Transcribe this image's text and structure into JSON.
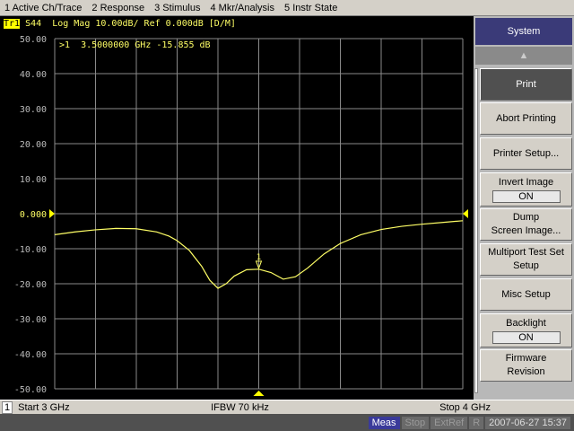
{
  "menu": [
    "1 Active Ch/Trace",
    "2 Response",
    "3 Stimulus",
    "4 Mkr/Analysis",
    "5 Instr State"
  ],
  "trace_header": {
    "trace": "Tr1",
    "text": "S44  Log Mag 10.00dB/ Ref 0.000dB [D/M]"
  },
  "marker_readout": ">1  3.5000000 GHz -15.855 dB",
  "marker_label": "1",
  "colors": {
    "trace": "#ffff66",
    "grid": "#8a8a8a",
    "softkey_title": "#3a3a78",
    "status_meas": "#3a3a9a"
  },
  "chart_data": {
    "type": "line",
    "ylim": [
      -50,
      50
    ],
    "xlim": [
      3.0,
      4.0
    ],
    "yticks": [
      "50.00",
      "40.00",
      "30.00",
      "20.00",
      "10.00",
      "0.000",
      "-10.00",
      "-20.00",
      "-30.00",
      "-40.00",
      "-50.00"
    ],
    "grid": true,
    "series": [
      {
        "x": [
          3.0,
          3.05,
          3.1,
          3.15,
          3.2,
          3.25,
          3.28,
          3.3,
          3.33,
          3.36,
          3.38,
          3.4,
          3.42,
          3.44,
          3.47,
          3.5,
          3.53,
          3.56,
          3.59,
          3.62,
          3.66,
          3.7,
          3.75,
          3.8,
          3.85,
          3.9,
          3.95,
          4.0
        ],
        "y": [
          -6.0,
          -5.2,
          -4.6,
          -4.2,
          -4.3,
          -5.2,
          -6.4,
          -7.7,
          -10.5,
          -15,
          -19,
          -21.3,
          -20,
          -17.8,
          -16,
          -15.855,
          -16.8,
          -18.7,
          -18,
          -15.5,
          -11.5,
          -8.5,
          -6,
          -4.5,
          -3.6,
          -3,
          -2.5,
          -2.0
        ]
      }
    ],
    "marker": {
      "x": 3.5,
      "y": -15.855
    }
  },
  "footer": {
    "channel": "1",
    "start": "Start 3 GHz",
    "ifbw": "IFBW 70 kHz",
    "stop": "Stop 4 GHz"
  },
  "status": [
    "Meas",
    "Stop",
    "ExtRef",
    "R",
    "2007-06-27 15:37"
  ],
  "softkeys": {
    "title": "System",
    "items": [
      {
        "label": "Print"
      },
      {
        "label": "Abort Printing"
      },
      {
        "label": "Printer Setup..."
      },
      {
        "label": "Invert Image",
        "value": "ON"
      },
      {
        "label": "Dump\nScreen Image..."
      },
      {
        "label": "Multiport Test Set\nSetup"
      },
      {
        "label": "Misc Setup"
      },
      {
        "label": "Backlight",
        "value": "ON"
      },
      {
        "label": "Firmware\nRevision"
      }
    ]
  }
}
